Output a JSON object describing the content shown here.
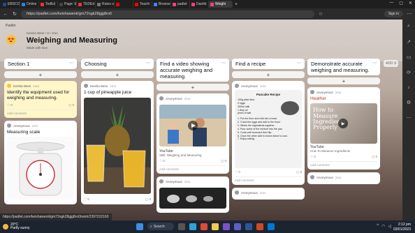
{
  "browser": {
    "tabs": [
      {
        "label": "EBSCO",
        "color": "#1a4c9c"
      },
      {
        "label": "Online",
        "color": "#1e88e5"
      },
      {
        "label": "TedEd",
        "color": "#e53935"
      },
      {
        "label": "Page: E",
        "color": "#444444"
      },
      {
        "label": "TEDEd",
        "color": "#e53935"
      },
      {
        "label": "Rules o",
        "color": "#777777"
      },
      {
        "label": "",
        "color": "#ff0000"
      },
      {
        "label": "Teachi",
        "color": "#ff0000"
      },
      {
        "label": "Browse",
        "color": "#4285f4"
      },
      {
        "label": "padlet",
        "color": "#ff4081"
      },
      {
        "label": "Dashb",
        "color": "#ff4081"
      },
      {
        "label": "Weighi",
        "color": "#ff4081"
      }
    ],
    "url": "https://padlet.com/keishawenii/gm72ngk28gjg8ro0",
    "sign_in": "Sign in",
    "status_url": "https://padlet.com/keishawenii/gm72ngk28gjg8ro0/wish/2397222160"
  },
  "padlet": {
    "brand": "Padlet",
    "author_line": "Keisha Weni  •  3  •  1mo",
    "title": "Weighing and Measuring",
    "subtitle": "Made with love",
    "add_section": "ADD S",
    "columns": [
      {
        "title": "Section 1",
        "cards": [
          {
            "author": "Keisha Weni",
            "time": "1mo",
            "title": "Identify the equipment used for weighing and measuring.",
            "reactions": "0",
            "comments": "0",
            "add_comment": "Add comment",
            "color": "yellow"
          },
          {
            "author": "Anonymous",
            "time": "1mo",
            "title": "Measuring scale",
            "image": "kitchen-scale"
          }
        ]
      },
      {
        "title": "Choosing",
        "cards": [
          {
            "author": "Keisha Weni",
            "time": "1mo",
            "title": "1 cup of pineapple juice",
            "image": "pineapple-juice",
            "reactions": "5",
            "comments": "0"
          }
        ]
      },
      {
        "title": "Find a video showing accurate weighing and measuring.",
        "cards": [
          {
            "author": "Anonymous",
            "time": "1mo",
            "link_source": "YouTube",
            "link_title": "Skill: Weighing and Measuring",
            "reactions": "0",
            "comments": "0",
            "add_comment": "Add comment",
            "image": "video-kitchen"
          },
          {
            "author": "Anonymous",
            "time": "1mo",
            "image": "measuring-spoons"
          }
        ]
      },
      {
        "title": "Find a recipe",
        "cards": [
          {
            "author": "Anonymous",
            "time": "1mo",
            "recipe_title": "Pancake Recipe",
            "ingredients": [
              "100g plain flour",
              "2 eggs",
              "300ml milk",
              "1 tbsp oil",
              "pinch of salt"
            ],
            "steps": [
              "1. Put the flour and milk into a bowl.",
              "2. Crack the eggs and add to the bowl.",
              "3. Whisk the ingredients together.",
              "4. Pour some of the mixture into the pan.",
              "5. Cook until browned then flip.",
              "6. Once the other side is brown leave to cool.",
              "7. Enjoy eating."
            ],
            "reactions": "0",
            "comments": "0",
            "add_comment": "Add comment"
          },
          {
            "author": "Anonymous",
            "time": "1mo"
          }
        ]
      },
      {
        "title": "Demonstrate accurate weighing and measuring.",
        "cards": [
          {
            "author": "Anonymous",
            "time": "1mo",
            "title": "Heather",
            "overlay": "How to Measure Ingredients Properly",
            "link_source": "YouTube",
            "link_title": "How To Measure Ingredients",
            "reactions": "0",
            "comments": "0",
            "add_comment": "Add comment"
          },
          {
            "author": "Anonymous",
            "time": "1mo"
          }
        ]
      }
    ]
  },
  "taskbar": {
    "temp": "20°C",
    "weather": "Partly sunny",
    "search": "Search",
    "time": "2:12 pm",
    "date": "03/01/2023"
  }
}
